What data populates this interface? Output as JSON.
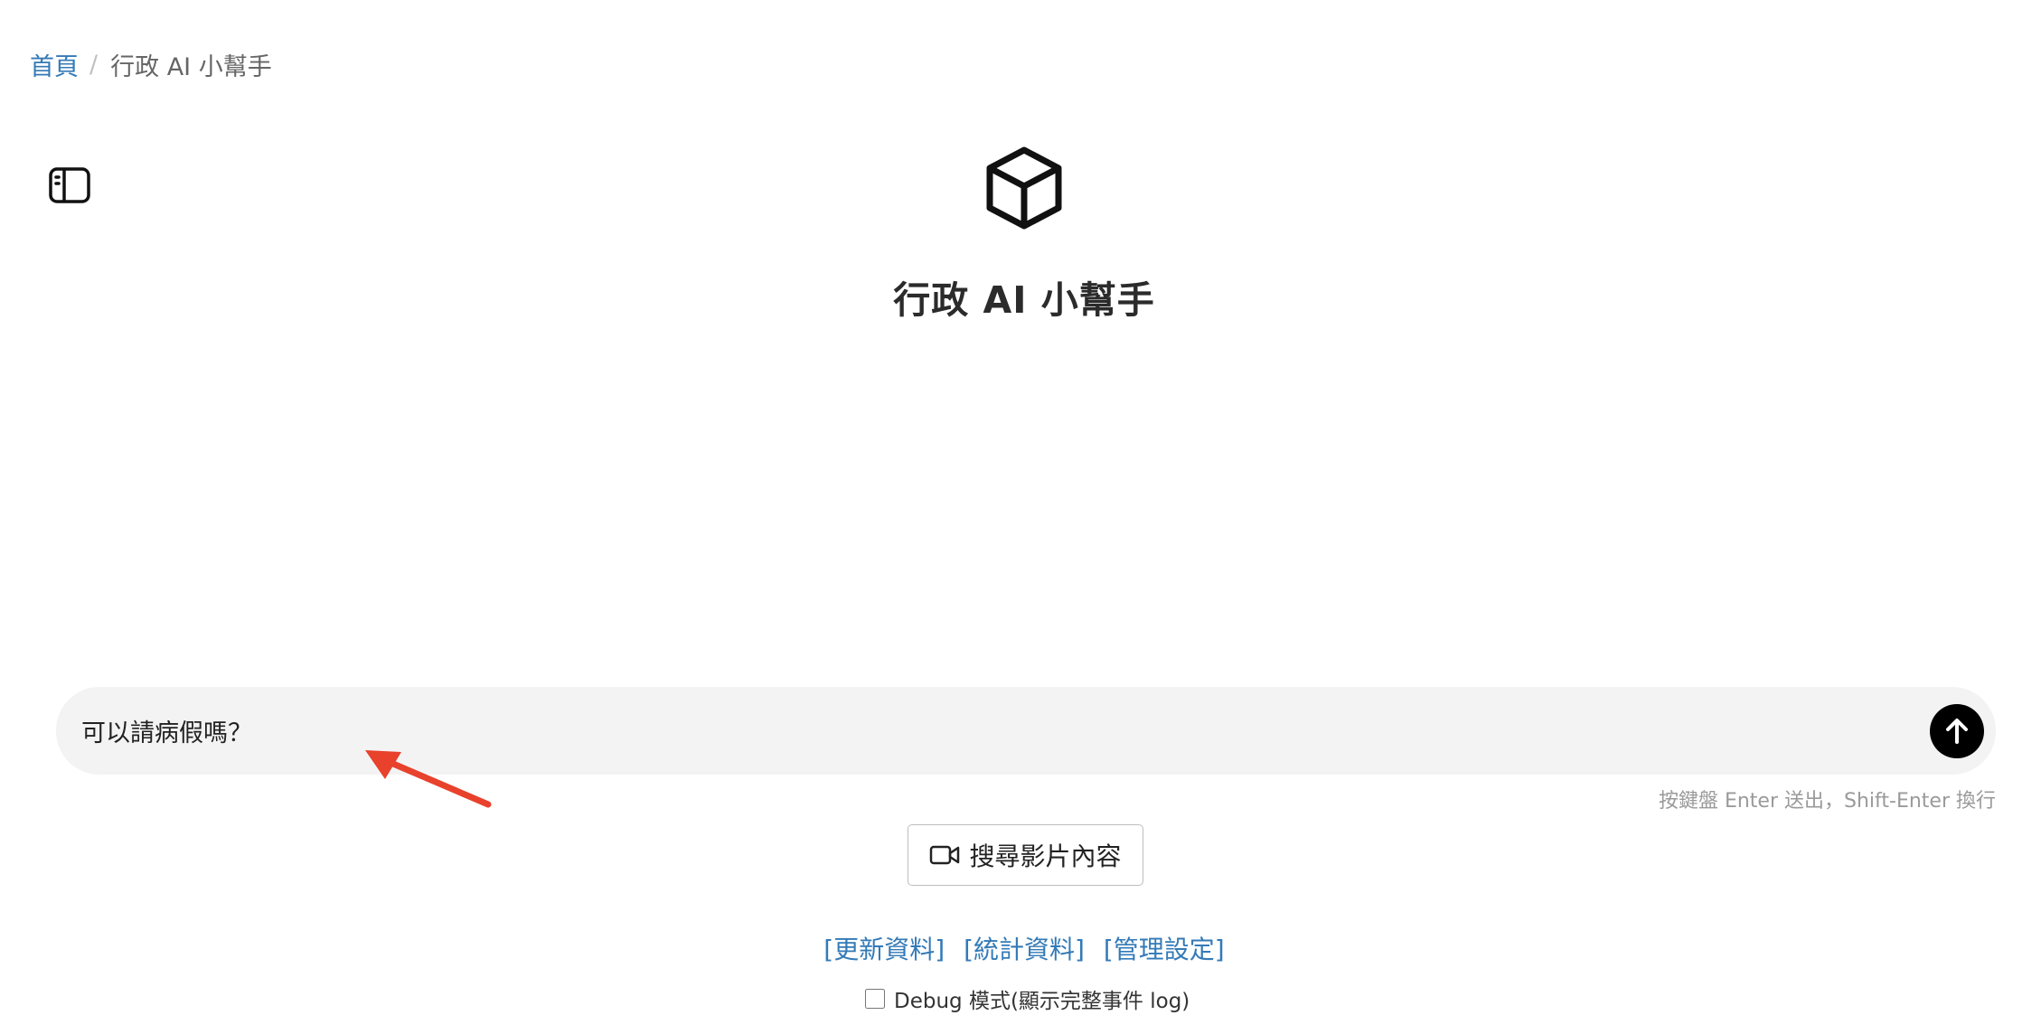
{
  "breadcrumb": {
    "home": "首頁",
    "separator": "/",
    "current": "行政 AI 小幫手"
  },
  "header": {
    "title": "行政 AI 小幫手"
  },
  "chat": {
    "input_value": "可以請病假嗎？",
    "send_icon": "arrow-up-icon",
    "hint": "按鍵盤 Enter 送出，Shift-Enter 換行"
  },
  "actions": {
    "video_search_label": "搜尋影片內容",
    "video_icon": "video-camera-icon"
  },
  "footer": {
    "links": [
      "[更新資料]",
      "[統計資料]",
      "[管理設定]"
    ],
    "debug_label": "Debug 模式(顯示完整事件 log)",
    "debug_checked": false
  },
  "colors": {
    "link": "#337ab7",
    "annotation_arrow": "#e8412c",
    "input_background": "#f3f3f3"
  }
}
